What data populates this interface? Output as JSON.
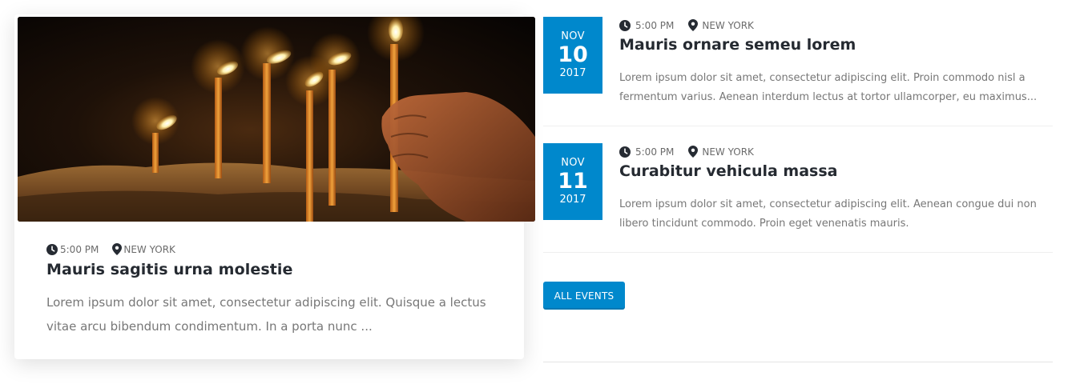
{
  "colors": {
    "accent": "#0088cc",
    "title": "#252a31",
    "text": "#777777"
  },
  "featured": {
    "image_alt": "lit candles",
    "time": "5:00 PM",
    "location": "NEW YORK",
    "title": "Mauris sagitis urna molestie",
    "excerpt": "Lorem ipsum dolor sit amet, consectetur adipiscing elit. Quisque a lectus vitae arcu bibendum condimentum. In a porta nunc ..."
  },
  "events": [
    {
      "month": "NOV",
      "day": "10",
      "year": "2017",
      "time": "5:00 PM",
      "location": "NEW YORK",
      "title": "Mauris ornare semeu lorem",
      "excerpt": "Lorem ipsum dolor sit amet, consectetur adipiscing elit. Proin commodo nisl a fermentum varius. Aenean interdum lectus at tortor ullamcorper, eu maximus..."
    },
    {
      "month": "NOV",
      "day": "11",
      "year": "2017",
      "time": "5:00 PM",
      "location": "NEW YORK",
      "title": "Curabitur vehicula massa",
      "excerpt": "Lorem ipsum dolor sit amet, consectetur adipiscing elit. Aenean congue dui non libero tincidunt commodo. Proin eget venenatis mauris."
    }
  ],
  "all_events_label": "ALL EVENTS",
  "icons": {
    "time": "clock-icon",
    "location": "map-pin-icon"
  }
}
